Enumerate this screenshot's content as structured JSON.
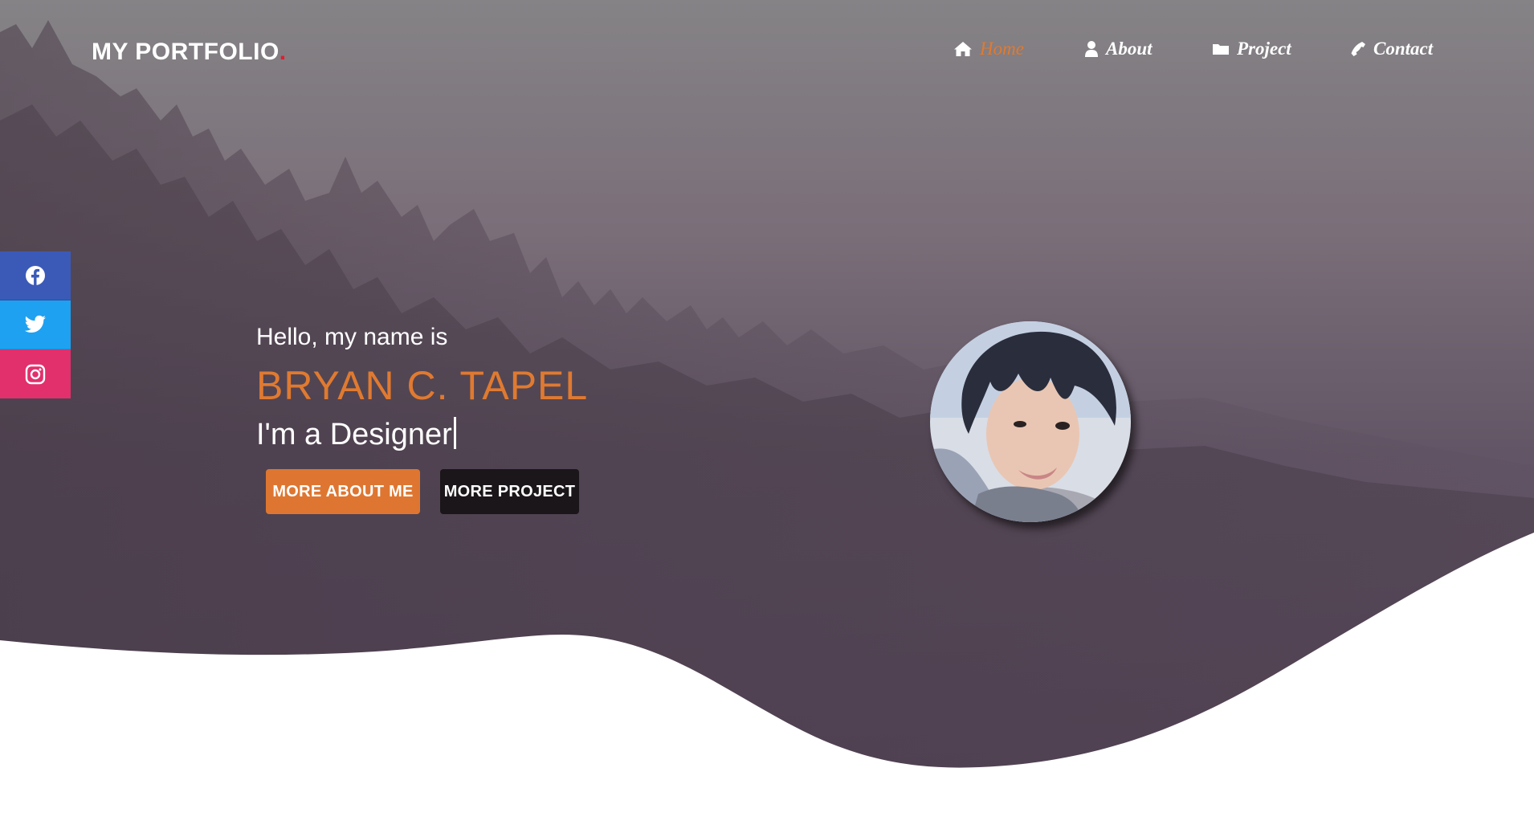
{
  "brand": {
    "name": "MY PORTFOLIO",
    "dot": ".",
    "dot_color": "#e01e2f"
  },
  "nav": {
    "items": [
      {
        "label": "Home",
        "icon": "home-icon",
        "active": true
      },
      {
        "label": "About",
        "icon": "user-icon",
        "active": false
      },
      {
        "label": "Project",
        "icon": "folder-icon",
        "active": false
      },
      {
        "label": "Contact",
        "icon": "phone-icon",
        "active": false
      }
    ]
  },
  "social": [
    {
      "name": "facebook",
      "icon": "facebook-icon",
      "color": "#3b5ab8"
    },
    {
      "name": "twitter",
      "icon": "twitter-icon",
      "color": "#1ea1f1"
    },
    {
      "name": "instagram",
      "icon": "instagram-icon",
      "color": "#e1306c"
    }
  ],
  "hero": {
    "greeting": "Hello, my name is",
    "name": "BRYAN C. TAPEL",
    "role": "I'm a Designer",
    "buttons": {
      "about": "MORE ABOUT ME",
      "project": "MORE PROJECT"
    },
    "avatar_icon": "profile-photo"
  },
  "colors": {
    "accent": "#e07a30",
    "overlay": "#5c4c5f",
    "dark_button": "#1a1619"
  }
}
